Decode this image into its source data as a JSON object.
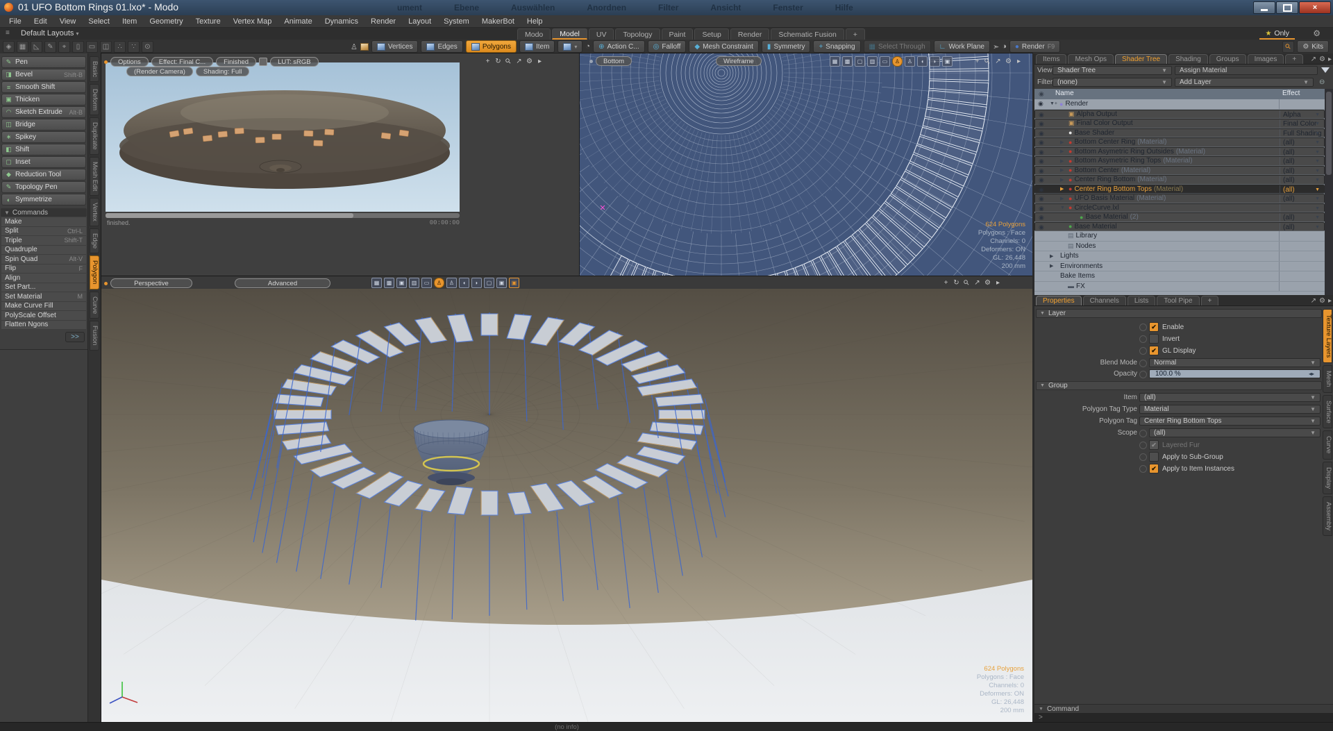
{
  "window": {
    "title": "01 UFO Bottom Rings 01.lxo* - Modo"
  },
  "background_menu": [
    "ument",
    "Ebene",
    "Auswählen",
    "Anordnen",
    "Filter",
    "Ansicht",
    "Fenster",
    "Hilfe"
  ],
  "menubar": [
    "File",
    "Edit",
    "View",
    "Select",
    "Item",
    "Geometry",
    "Texture",
    "Vertex Map",
    "Animate",
    "Dynamics",
    "Render",
    "Layout",
    "System",
    "MakerBot",
    "Help"
  ],
  "layout_bar": {
    "default_layouts": "Default Layouts",
    "only_label": "Only"
  },
  "main_tabs": [
    {
      "label": "Modo"
    },
    {
      "label": "Model",
      "active": true
    },
    {
      "label": "UV"
    },
    {
      "label": "Topology"
    },
    {
      "label": "Paint"
    },
    {
      "label": "Setup"
    },
    {
      "label": "Render"
    },
    {
      "label": "Schematic Fusion"
    },
    {
      "label": "+"
    }
  ],
  "quick_icons": [
    "◈",
    "▦",
    "◺",
    "✎",
    "⌖",
    "▯",
    "▭",
    "◫",
    "∴",
    "∵",
    "⊙"
  ],
  "selection_modes": [
    {
      "label": "Vertices"
    },
    {
      "label": "Edges"
    },
    {
      "label": "Polygons",
      "active": true
    },
    {
      "label": "Item"
    }
  ],
  "toolbar": {
    "features": [
      {
        "icon": "⊕",
        "label": "Action C..."
      },
      {
        "icon": "◎",
        "label": "Falloff"
      },
      {
        "icon": "◆",
        "label": "Mesh Constraint"
      },
      {
        "icon": "▮",
        "label": "Symmetry"
      },
      {
        "icon": "+",
        "label": "Snapping"
      },
      {
        "icon": "▦",
        "label": "Select Through",
        "disabled": true
      },
      {
        "icon": "∟",
        "label": "Work Plane"
      }
    ],
    "render_button": {
      "label": "Render",
      "shortcut": "F9"
    },
    "kits_label": "Kits"
  },
  "left_tools": [
    {
      "icon": "✎",
      "label": "Pen"
    },
    {
      "icon": "◨",
      "label": "Bevel",
      "shortcut": "Shift-B"
    },
    {
      "icon": "≡",
      "label": "Smooth Shift"
    },
    {
      "icon": "▣",
      "label": "Thicken"
    },
    {
      "icon": "◠",
      "label": "Sketch Extrude",
      "shortcut": "Alt-B"
    },
    {
      "icon": "◫",
      "label": "Bridge"
    },
    {
      "icon": "∗",
      "label": "Spikey"
    },
    {
      "icon": "◧",
      "label": "Shift"
    },
    {
      "icon": "▢",
      "label": "Inset"
    },
    {
      "icon": "◆",
      "label": "Reduction Tool"
    },
    {
      "icon": "✎",
      "label": "Topology Pen"
    },
    {
      "icon": "◐",
      "label": "Symmetrize"
    }
  ],
  "commands": {
    "header": "Commands",
    "items": [
      {
        "label": "Make"
      },
      {
        "label": "Split",
        "shortcut": "Ctrl-L"
      },
      {
        "label": "Triple",
        "shortcut": "Shift-T"
      },
      {
        "label": "Quadruple"
      },
      {
        "label": "Spin Quad",
        "shortcut": "Alt-V"
      },
      {
        "label": "Flip",
        "shortcut": "F"
      },
      {
        "label": "Align"
      },
      {
        "label": "Set Part..."
      },
      {
        "label": "Set Material",
        "shortcut": "M"
      },
      {
        "label": "Make Curve Fill"
      },
      {
        "label": "PolyScale Offset"
      },
      {
        "label": "Flatten Ngons"
      }
    ],
    "more_label": ">>"
  },
  "left_vertical_tabs": [
    {
      "label": "Basic"
    },
    {
      "label": "Deform"
    },
    {
      "label": "Duplicate"
    },
    {
      "label": "Mesh Edit"
    },
    {
      "label": "Vertex"
    },
    {
      "label": "Edge"
    },
    {
      "label": "Polygon",
      "active": true
    },
    {
      "label": "Curve"
    },
    {
      "label": "Fusion"
    }
  ],
  "render_view": {
    "pills_row1": [
      "Options",
      "Effect: Final C...",
      "Finished"
    ],
    "lut_pill": "LUT: sRGB",
    "pills_row2": [
      "(Render Camera)",
      "Shading: Full"
    ],
    "status_left": "finished.",
    "time": "00:00:00"
  },
  "wireframe_view": {
    "view_name": "Bottom",
    "shading": "Wireframe"
  },
  "perspective_view": {
    "view_name": "Perspective",
    "shading": "Advanced"
  },
  "viewport_stats": {
    "polygons": "624 Polygons",
    "lines": [
      "Polygons : Face",
      "Channels: 0",
      "Deformers: ON",
      "GL: 26,448",
      "200 mm"
    ]
  },
  "right_panel": {
    "tabs": [
      {
        "label": "Items"
      },
      {
        "label": "Mesh Ops"
      },
      {
        "label": "Shader Tree",
        "active": true
      },
      {
        "label": "Shading"
      },
      {
        "label": "Groups"
      },
      {
        "label": "Images"
      },
      {
        "label": "+"
      }
    ],
    "view_label": "View",
    "view_value": "Shader Tree",
    "assign_material": "Assign Material",
    "filter_label": "Filter",
    "filter_value": "(none)",
    "add_layer": "Add Layer",
    "columns": {
      "name": "Name",
      "effect": "Effect"
    },
    "rows": [
      {
        "eye": true,
        "arrow": "▼+",
        "icon": "●",
        "kind": "render",
        "indent": 0,
        "name": "Render"
      },
      {
        "eye": true,
        "dd": true,
        "icon": "▣",
        "kind": "output",
        "indent": 1,
        "name": "Alpha Output",
        "effect": "Alpha"
      },
      {
        "eye": true,
        "dd": true,
        "icon": "▣",
        "kind": "output",
        "indent": 1,
        "name": "Final Color Output",
        "effect": "Final Color"
      },
      {
        "eye": true,
        "dd": true,
        "icon": "●",
        "kind": "shader",
        "indent": 1,
        "name": "Base Shader",
        "effect": "Full Shading"
      },
      {
        "eye": true,
        "dd": true,
        "arrow": "▶",
        "icon": "●",
        "kind": "material",
        "indent": 1,
        "name": "Bottom Center Ring",
        "suffix": "(Material)",
        "effect": "(all)"
      },
      {
        "eye": true,
        "dd": true,
        "arrow": "▶",
        "icon": "●",
        "kind": "material",
        "indent": 1,
        "name": "Bottom Asymetric Ring Outsides",
        "suffix": "(Material)",
        "effect": "(all)"
      },
      {
        "eye": true,
        "dd": true,
        "arrow": "▶",
        "icon": "●",
        "kind": "material",
        "indent": 1,
        "name": "Bottom Asymetric Ring Tops",
        "suffix": "(Material)",
        "effect": "(all)"
      },
      {
        "eye": true,
        "dd": true,
        "arrow": "▶",
        "icon": "●",
        "kind": "material",
        "indent": 1,
        "name": "Bottom Center",
        "suffix": "(Material)",
        "effect": "(all)"
      },
      {
        "eye": true,
        "dd": true,
        "arrow": "▶",
        "icon": "●",
        "kind": "material",
        "indent": 1,
        "name": "Center Ring Bottom",
        "suffix": "(Material)",
        "effect": "(all)"
      },
      {
        "eye": true,
        "dd": true,
        "arrow": "▶",
        "icon": "●",
        "kind": "material",
        "indent": 1,
        "name": "Center Ring Bottom Tops",
        "suffix": "(Material)",
        "effect": "(all)",
        "selected": true
      },
      {
        "eye": true,
        "dd": true,
        "arrow": "▶",
        "icon": "●",
        "kind": "material",
        "indent": 1,
        "name": "UFO Basis Material",
        "suffix": "(Material)",
        "effect": "(all)"
      },
      {
        "eye": true,
        "dd": true,
        "arrow": "▼",
        "icon": "●",
        "kind": "material",
        "indent": 1,
        "name": "CircleCurve.lxl"
      },
      {
        "eye": true,
        "dd": true,
        "icon": "●",
        "kind": "matgreen",
        "indent": 2,
        "name": "Base Material",
        "suffix": "(2)",
        "effect": "(all)"
      },
      {
        "eye": true,
        "dd": true,
        "icon": "●",
        "kind": "matgreen",
        "indent": 1,
        "name": "Base Material",
        "effect": "(all)"
      },
      {
        "noeye": true,
        "icon": "▤",
        "kind": "folder",
        "indent": 1,
        "name": "Library"
      },
      {
        "noeye": true,
        "icon": "▤",
        "kind": "folder",
        "indent": 1,
        "name": "Nodes"
      },
      {
        "noeye": true,
        "arrow": "▶",
        "indent": 0,
        "name": "Lights"
      },
      {
        "noeye": true,
        "arrow": "▶",
        "indent": 0,
        "name": "Environments"
      },
      {
        "noeye": true,
        "indent": 0,
        "name": "Bake Items"
      },
      {
        "noeye": true,
        "icon": "▬",
        "kind": "fx",
        "indent": 1,
        "name": "FX"
      }
    ]
  },
  "properties": {
    "tabs": [
      {
        "label": "Properties",
        "active": true
      },
      {
        "label": "Channels"
      },
      {
        "label": "Lists"
      },
      {
        "label": "Tool Pipe"
      },
      {
        "label": "+"
      }
    ],
    "layer": {
      "header": "Layer",
      "checks": [
        {
          "label": "Enable",
          "checked": true
        },
        {
          "label": "Invert"
        },
        {
          "label": "GL Display",
          "checked": true
        }
      ],
      "blend_label": "Blend Mode",
      "blend_value": "Normal",
      "opacity_label": "Opacity",
      "opacity_value": "100.0 %"
    },
    "group": {
      "header": "Group",
      "item_label": "Item",
      "item_value": "(all)",
      "tag_type_label": "Polygon Tag Type",
      "tag_type_value": "Material",
      "tag_label": "Polygon Tag",
      "tag_value": "Center Ring Bottom Tops",
      "scope_label": "Scope",
      "scope_value": "(all)",
      "checks": [
        {
          "label": "Layered Fur",
          "checked": true,
          "disabled": true
        },
        {
          "label": "Apply to Sub-Group"
        },
        {
          "label": "Apply to Item Instances",
          "checked": true
        }
      ]
    },
    "side_tabs": [
      {
        "label": "Texture Layers",
        "active": true
      },
      {
        "label": "Mesh"
      },
      {
        "label": "Surface"
      },
      {
        "label": "Curve"
      },
      {
        "label": "Display"
      },
      {
        "label": "Assembly"
      }
    ]
  },
  "command_bar": {
    "label": "Command",
    "prompt": ">"
  },
  "status_bar": {
    "text": "(no info)"
  },
  "icons": {
    "gear": "⚙",
    "star": "★",
    "rotate": "↻",
    "magnifier": "⚲",
    "expand": "↗",
    "more": "▸",
    "pan": "+",
    "eye": "◉",
    "caret": "▾"
  },
  "colors": {
    "accent_orange": "#e8952e",
    "selection_text": "#e8a13c",
    "wireframe_bg": "#42567c",
    "dome_tan": "#8a8071",
    "sky_blue": "#aec8de"
  }
}
